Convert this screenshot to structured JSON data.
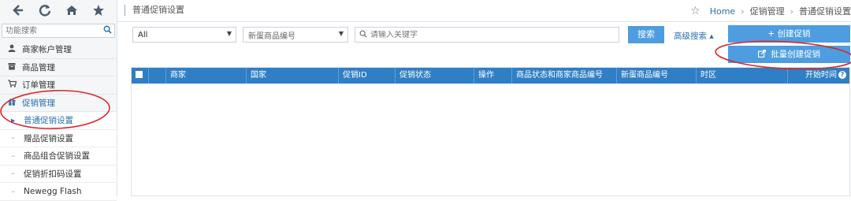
{
  "topbar": {
    "icons": [
      "back-arrow-icon",
      "refresh-icon",
      "home-icon",
      "star-icon"
    ],
    "page_title": "普通促销设置",
    "breadcrumb": {
      "star_icon": "star-outline-icon",
      "home": "Home",
      "sep": "›",
      "level1": "促销管理",
      "level2": "普通促销设置"
    }
  },
  "sidebar": {
    "search_placeholder": "功能搜索",
    "items": [
      {
        "label": "商家帐户管理",
        "icon": "user-icon"
      },
      {
        "label": "商品管理",
        "icon": "box-icon"
      },
      {
        "label": "订单管理",
        "icon": "cart-icon"
      },
      {
        "label": "促销管理",
        "icon": "gift-icon"
      }
    ],
    "sub_items": [
      {
        "label": "普通促销设置"
      },
      {
        "label": "赠品促销设置"
      },
      {
        "label": "商品组合促销设置"
      },
      {
        "label": "促销折扣码设置"
      },
      {
        "label": "Newegg Flash"
      }
    ]
  },
  "filters": {
    "select1_value": "All",
    "select2_value": "新蛋商品编号",
    "keyword_placeholder": "请输入关键字",
    "search_button": "搜索",
    "advanced_search": "高级搜索 ▴"
  },
  "actions": {
    "create_label": "+ 创建促销",
    "batch_label": "批量创建促销"
  },
  "table": {
    "columns": [
      "",
      "",
      "商家",
      "国家",
      "促销ID",
      "促销状态",
      "操作",
      "商品状态和商家商品编号",
      "新蛋商品编号",
      "时区",
      "开始时间"
    ],
    "rows": []
  },
  "colors": {
    "header_blue": "#2f7fc6",
    "button_blue": "#4d9de0",
    "link_blue": "#2a6fb0",
    "annotation_red": "#d9262b"
  }
}
